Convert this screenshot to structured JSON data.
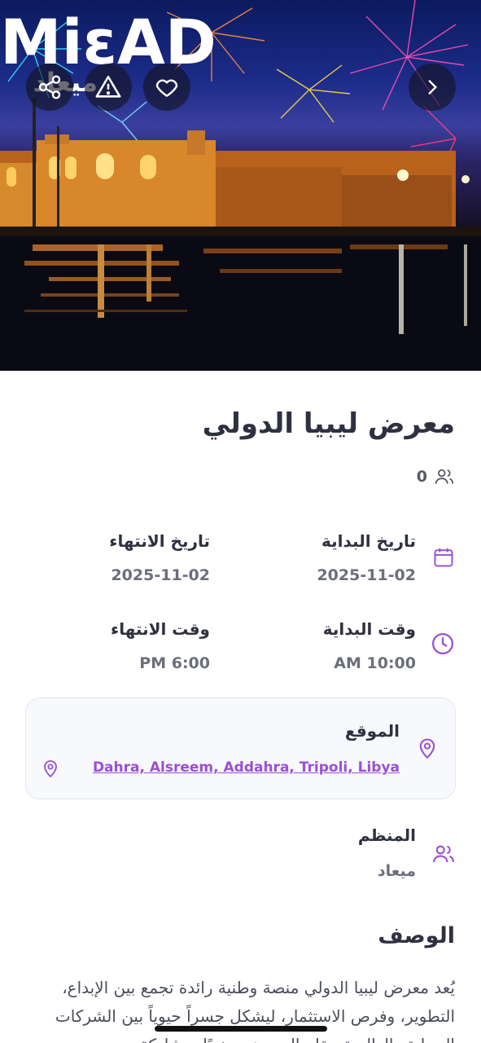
{
  "colors": {
    "accent": "#9b4fd6",
    "title": "#2e3140",
    "muted": "#6b6f7b",
    "logo_pink": "#ff3fc1"
  },
  "hero": {
    "logo_text_latin": "MiεAD",
    "logo_text_arabic": "ميعاد",
    "icons": [
      "share-icon",
      "warning-icon",
      "heart-icon",
      "chevron-right-icon"
    ]
  },
  "event": {
    "title": "معرض ليبيا الدولي",
    "attendees_count": "0"
  },
  "dates": {
    "start_label": "تاريخ البداية",
    "start_value": "2025-11-02",
    "end_label": "تاريخ الانتهاء",
    "end_value": "2025-11-02"
  },
  "times": {
    "start_label": "وقت البداية",
    "start_value": "AM 10:00",
    "end_label": "وقت الانتهاء",
    "end_value": "PM 6:00"
  },
  "location": {
    "label": "الموقع",
    "address": "Dahra, Alsreem, Addahra, Tripoli, Libya"
  },
  "organizer": {
    "label": "المنظم",
    "name": "ميعاد"
  },
  "description": {
    "title": "الوصف",
    "text": "يُعد معرض ليبيا الدولي منصة وطنية رائدة تجمع بين الإبداع، التطوير، وفرص الاستثمار، ليشكل جسراً حيوياً بين الشركات المحلية والعالمية. يقام المعرض سنويًا بمشاركة"
  }
}
